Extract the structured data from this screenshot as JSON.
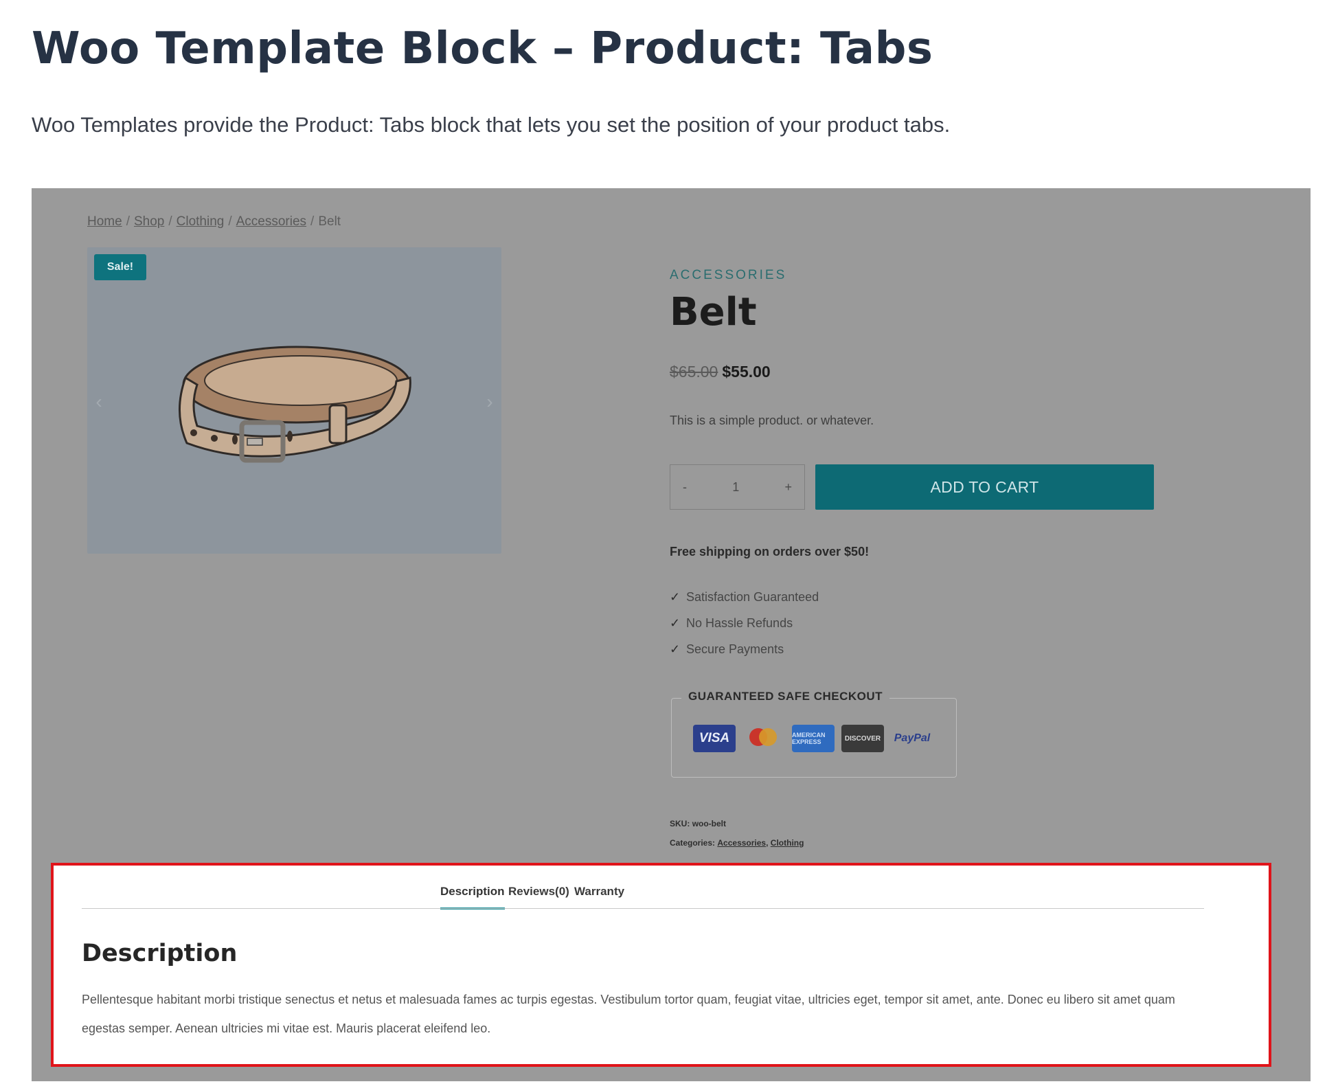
{
  "doc": {
    "title": "Woo Template Block – Product: Tabs",
    "intro": "Woo Templates provide the Product: Tabs block that lets you set the position of your product tabs."
  },
  "breadcrumb": {
    "items": [
      "Home",
      "Shop",
      "Clothing",
      "Accessories"
    ],
    "separator": "/",
    "current": "Belt"
  },
  "gallery": {
    "sale_badge": "Sale!",
    "prev_icon": "chevron-left-icon",
    "next_icon": "chevron-right-icon",
    "prev_glyph": "‹",
    "next_glyph": "›"
  },
  "product": {
    "category": "ACCESSORIES",
    "title": "Belt",
    "price_old": "$65.00",
    "price_new": "$55.00",
    "short_description": "This is a simple product. or whatever.",
    "qty_minus": "-",
    "qty_value": "1",
    "qty_plus": "+",
    "add_to_cart": "ADD TO CART",
    "shipping_note": "Free shipping on orders over $50!",
    "usps": [
      "Satisfaction Guaranteed",
      "No Hassle Refunds",
      "Secure Payments"
    ],
    "check_glyph": "✓"
  },
  "checkout": {
    "legend": "GUARANTEED SAFE CHECKOUT",
    "cards": [
      "VISA",
      "",
      "AMERICAN EXPRESS",
      "DISCOVER",
      "PayPal"
    ]
  },
  "meta": {
    "sku_label": "SKU:",
    "sku_value": "woo-belt",
    "categories_label": "Categories:",
    "categories": [
      "Accessories",
      "Clothing"
    ],
    "categories_sep": ","
  },
  "tabs": {
    "items": [
      "Description",
      "Reviews(0)",
      "Warranty"
    ],
    "active": "Description",
    "heading": "Description",
    "content": "Pellentesque habitant morbi tristique senectus et netus et malesuada fames ac turpis egestas. Vestibulum tortor quam, feugiat vitae, ultricies eget, tempor sit amet, ante. Donec eu libero sit amet quam egestas semper. Aenean ultricies mi vitae est. Mauris placerat eleifend leo."
  },
  "colors": {
    "accent": "#0d6a74",
    "highlight_border": "#e0141a",
    "overlay_gray": "#9a9a9a",
    "title": "#263244"
  }
}
